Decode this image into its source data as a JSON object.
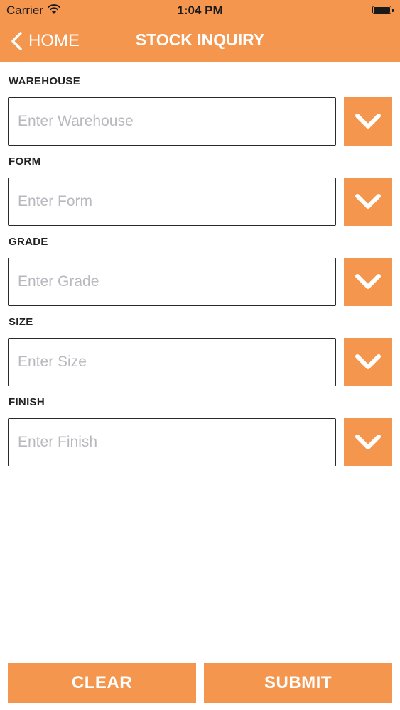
{
  "status_bar": {
    "carrier": "Carrier",
    "time": "1:04 PM"
  },
  "nav": {
    "back_label": "HOME",
    "title": "STOCK INQUIRY"
  },
  "fields": [
    {
      "label": "WAREHOUSE",
      "placeholder": "Enter Warehouse",
      "value": ""
    },
    {
      "label": "FORM",
      "placeholder": "Enter Form",
      "value": ""
    },
    {
      "label": "GRADE",
      "placeholder": "Enter Grade",
      "value": ""
    },
    {
      "label": "SIZE",
      "placeholder": "Enter Size",
      "value": ""
    },
    {
      "label": "FINISH",
      "placeholder": "Enter Finish",
      "value": ""
    }
  ],
  "actions": {
    "clear_label": "CLEAR",
    "submit_label": "SUBMIT"
  },
  "icons": {
    "back": "chevron-left-icon",
    "dropdown": "chevron-down-icon",
    "wifi": "wifi-icon",
    "battery": "battery-icon"
  },
  "colors": {
    "accent": "#F4964E",
    "header_text": "#FFFFFF",
    "label_text": "#222222",
    "placeholder_text": "#B8B8BE",
    "input_border": "#2A2A2A"
  }
}
